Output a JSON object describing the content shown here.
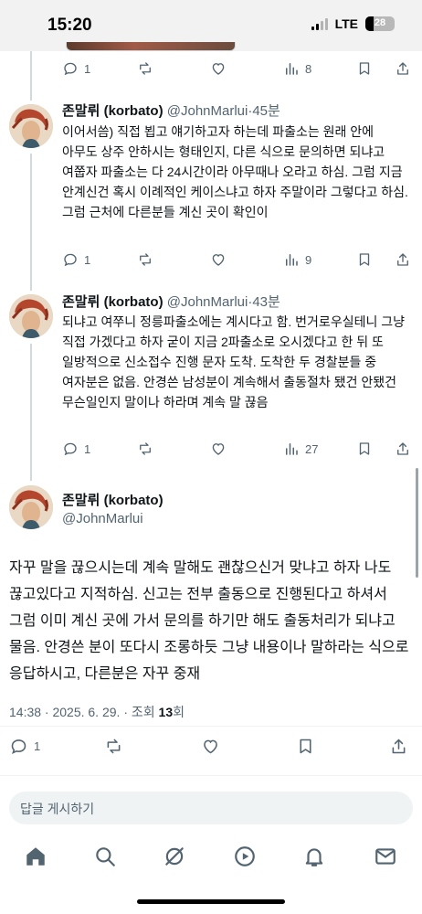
{
  "status": {
    "time": "15:20",
    "network": "LTE",
    "battery": "28",
    "battery_level": 0.28
  },
  "colors": {
    "text": "#0f1419",
    "secondary": "#536471",
    "divider": "#eff3f4",
    "reply_bg": "#eff3f4"
  },
  "top_actions": {
    "reply": "1",
    "retweet": "",
    "like": "",
    "views": "8"
  },
  "tweets": [
    {
      "name": "존말뤼 (korbato)",
      "handle": "@JohnMarlui",
      "time": "45분",
      "body": "이어서씀) 직접 뵙고 얘기하고자 하는데 파출소는 원래 안에 아무도 상주 안하시는 형태인지, 다른 식으로 문의하면 되냐고 여쭙자 파출소는 다 24시간이라 아무때나 오라고 하심. 그럼 지금 안계신건 혹시 이례적인 케이스냐고 하자 주말이라 그렇다고 하심. 그럼 근처에 다른분들 계신 곳이 확인이",
      "reply_count": "1",
      "views": "9"
    },
    {
      "name": "존말뤼 (korbato)",
      "handle": "@JohnMarlui",
      "time": "43분",
      "body": "되냐고 여쭈니 정릉파출소에는 계시다고 함. 번거로우실테니 그냥 직접 가겠다고 하자 굳이 지금 2파출소로 오시겠다고 한 뒤 또 일방적으로 신소접수 진행 문자 도착. 도착한 두 경찰분들 중 여자분은 없음. 안경쓴 남성분이 계속해서 출동절차 됐건 안됐건 무슨일인지 말이나 하라며 계속 말 끊음",
      "reply_count": "1",
      "views": "27"
    }
  ],
  "main_tweet": {
    "name": "존말뤼 (korbato)",
    "handle": "@JohnMarlui",
    "body": "자꾸 말을 끊으시는데 계속 말해도 괜찮으신거 맞냐고 하자 나도 끊고있다고 지적하심. 신고는 전부 출동으로 진행된다고 하셔서 그럼 이미 계신 곳에 가서 문의를 하기만 해도 출동처리가 되냐고 물음. 안경쓴 분이 또다시 조롱하듯 그냥 내용이나 말하라는 식으로 응답하시고, 다른분은 자꾸 중재",
    "timestamp": "14:38 · 2025. 6. 29. · 조회",
    "view_count": "13",
    "view_suffix": "회",
    "reply_count": "1"
  },
  "reply_box": {
    "placeholder": "답글 게시하기"
  },
  "nav": [
    "home-icon",
    "search-icon",
    "grok-icon",
    "video-icon",
    "notifications-icon",
    "messages-icon"
  ]
}
